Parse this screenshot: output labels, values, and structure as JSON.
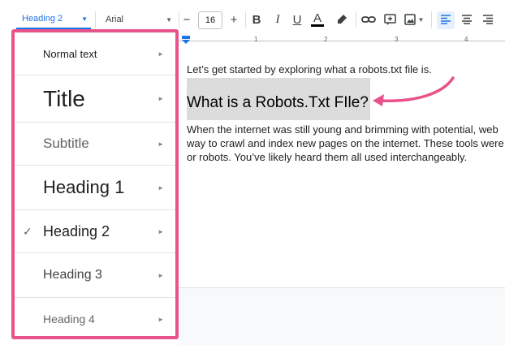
{
  "toolbar": {
    "style_select": "Heading 2",
    "font_select": "Arial",
    "font_size": "16",
    "minus": "−",
    "plus": "+",
    "bold": "B",
    "italic": "I",
    "underline": "U",
    "text_color": "A"
  },
  "ruler": {
    "marks": [
      "1",
      "2",
      "3",
      "4"
    ]
  },
  "document": {
    "intro": "Let’s get started by exploring what a robots.txt file is.",
    "heading": "What is a Robots.Txt FIle?",
    "paragraph": [
      "When the internet was still young and brimming with potential, web",
      "way to crawl and index new pages on the internet. These tools were",
      "or robots. You’ve likely heard them all used interchangeably."
    ]
  },
  "dropdown": {
    "items": [
      {
        "label": "Normal text",
        "checked": false
      },
      {
        "label": "Title",
        "checked": false
      },
      {
        "label": "Subtitle",
        "checked": false
      },
      {
        "label": "Heading 1",
        "checked": false
      },
      {
        "label": "Heading 2",
        "checked": true
      },
      {
        "label": "Heading 3",
        "checked": false
      },
      {
        "label": "Heading 4",
        "checked": false
      }
    ],
    "check_mark": "✓",
    "chevron": "►"
  },
  "colors": {
    "highlight_border": "#e8538a",
    "accent": "#1a73e8",
    "heading_highlight": "#dcdcdc"
  },
  "icons": [
    "highlighter-icon",
    "link-icon",
    "comment-icon",
    "image-icon",
    "align-left-icon",
    "align-center-icon",
    "align-right-icon",
    "arrow-annotation-icon"
  ]
}
